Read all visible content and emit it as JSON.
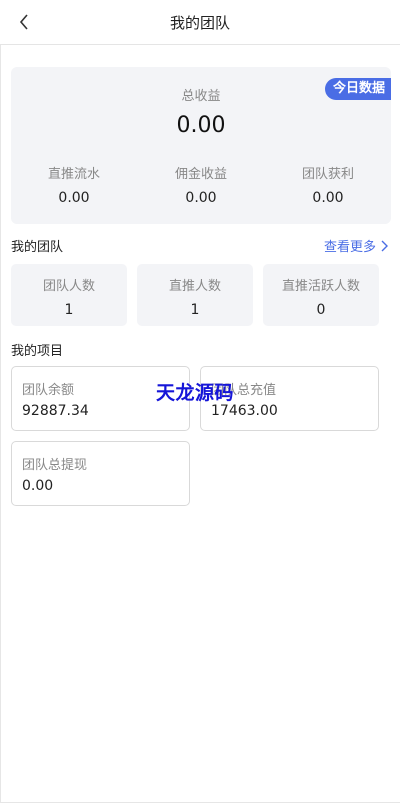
{
  "header": {
    "title": "我的团队"
  },
  "summary": {
    "badge": "今日数据",
    "total_label": "总收益",
    "total_value": "0.00",
    "stats": [
      {
        "label": "直推流水",
        "value": "0.00"
      },
      {
        "label": "佣金收益",
        "value": "0.00"
      },
      {
        "label": "团队获利",
        "value": "0.00"
      }
    ]
  },
  "team": {
    "title": "我的团队",
    "see_more": "查看更多",
    "counts": [
      {
        "label": "团队人数",
        "value": "1"
      },
      {
        "label": "直推人数",
        "value": "1"
      },
      {
        "label": "直推活跃人数",
        "value": "0"
      }
    ]
  },
  "projects": {
    "title": "我的项目",
    "items": [
      {
        "label": "团队余额",
        "value": "92887.34"
      },
      {
        "label": "团队总充值",
        "value": "17463.00"
      },
      {
        "label": "团队总提现",
        "value": "0.00"
      }
    ]
  },
  "watermark": "天龙源码",
  "colors": {
    "accent": "#4a6de5",
    "card_bg": "#f3f4f7",
    "watermark": "#1515d8"
  }
}
